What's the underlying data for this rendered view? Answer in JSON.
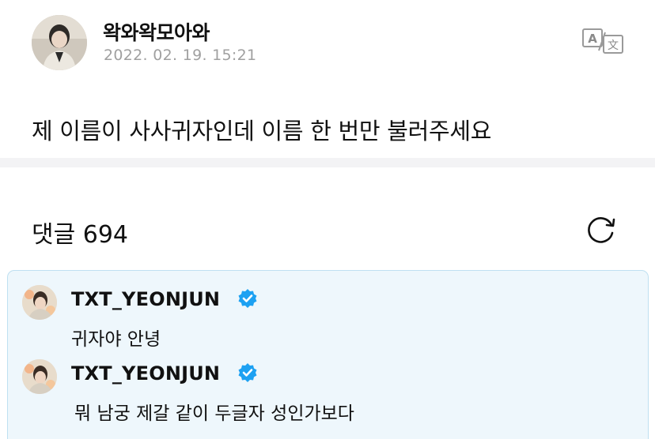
{
  "post": {
    "author": "왁와왁모아와",
    "date": "2022. 02. 19. 15:21",
    "body": "제 이름이 사사귀자인데 이름 한 번만 불러주세요"
  },
  "comments_header": {
    "title": "댓글 694"
  },
  "comments": [
    {
      "author": "TXT_YEONJUN",
      "verified": true,
      "text": "귀자야 안녕"
    },
    {
      "author": "TXT_YEONJUN",
      "verified": true,
      "text": "뭐 남궁 제갈 같이 두글자 성인가보다"
    }
  ],
  "colors": {
    "highlight_bg": "#eef7fc",
    "highlight_border": "#bfe0f1",
    "verified_badge": "#1da1f2",
    "date_gray": "#a0a0a0",
    "divider": "#f3f3f5"
  },
  "icons": {
    "translate": "translate-icon",
    "refresh": "refresh-icon",
    "verified": "verified-badge-icon"
  }
}
